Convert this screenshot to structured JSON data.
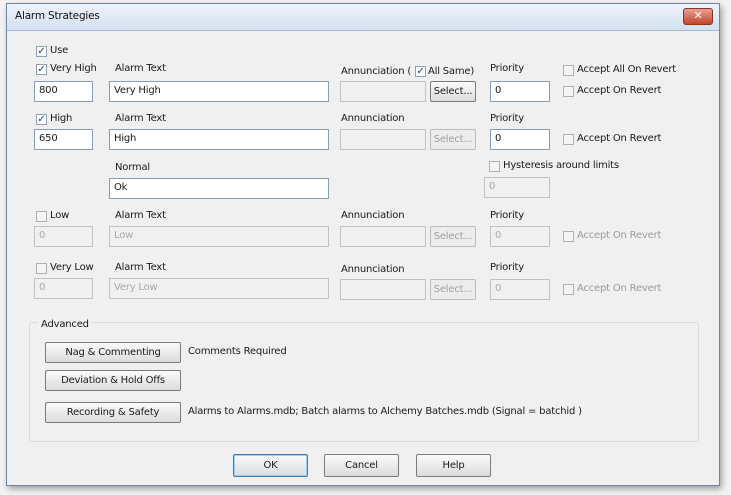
{
  "dialog": {
    "title": "Alarm Strategies",
    "close_glyph": "✕"
  },
  "use": {
    "label": "Use",
    "checked": true
  },
  "check_glyph": "✓",
  "very_high": {
    "label": "Very High",
    "value": "800",
    "alarm_text_label": "Alarm Text",
    "alarm_text": "Very High",
    "annunciation_label": "Annunciation (",
    "all_same_label": "All Same)",
    "select_label": "Select...",
    "priority_label": "Priority",
    "priority": "0",
    "accept_all_label": "Accept All On Revert",
    "accept_label": "Accept On Revert"
  },
  "high": {
    "label": "High",
    "value": "650",
    "alarm_text_label": "Alarm Text",
    "alarm_text": "High",
    "annunciation_label": "Annunciation",
    "select_label": "Select...",
    "priority_label": "Priority",
    "priority": "0",
    "accept_label": "Accept On Revert"
  },
  "normal": {
    "label": "Normal",
    "text": "Ok",
    "hysteresis_label": "Hysteresis around limits",
    "hysteresis_value": "0"
  },
  "low": {
    "label": "Low",
    "value": "0",
    "alarm_text_label": "Alarm Text",
    "alarm_text": "Low",
    "annunciation_label": "Annunciation",
    "select_label": "Select...",
    "priority_label": "Priority",
    "priority": "0",
    "accept_label": "Accept On Revert"
  },
  "very_low": {
    "label": "Very Low",
    "value": "0",
    "alarm_text_label": "Alarm Text",
    "alarm_text": "Very Low",
    "annunciation_label": "Annunciation",
    "select_label": "Select...",
    "priority_label": "Priority",
    "priority": "0",
    "accept_label": "Accept On Revert"
  },
  "advanced": {
    "label": "Advanced",
    "nag_button": "Nag & Commenting",
    "nag_status": "Comments Required",
    "deviation_button": "Deviation & Hold Offs",
    "recording_button": "Recording & Safety",
    "recording_status": "Alarms to Alarms.mdb; Batch alarms to Alchemy Batches.mdb (Signal = batchid )"
  },
  "footer": {
    "ok": "OK",
    "cancel": "Cancel",
    "help": "Help"
  }
}
